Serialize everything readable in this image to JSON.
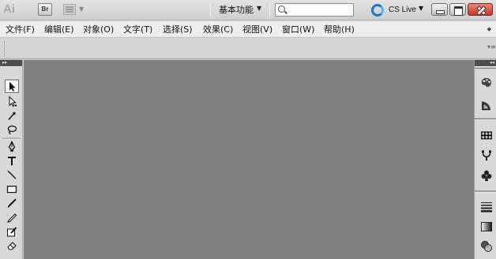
{
  "titlebar": {
    "app_logo": "Ai",
    "bridge_button": "Br",
    "workspace": "基本功能",
    "search_placeholder": "",
    "cslive": "CS Live",
    "icons": [
      "arrange-documents-icon",
      "caret-down-icon",
      "search-icon",
      "cslive-icon",
      "minimize-icon",
      "restore-icon",
      "close-icon"
    ]
  },
  "menu": {
    "items": [
      "文件(F)",
      "编辑(E)",
      "对象(O)",
      "文字(T)",
      "选择(S)",
      "效果(C)",
      "视图(V)",
      "窗口(W)",
      "帮助(H)"
    ]
  },
  "toolbox": {
    "collapse_glyph": "▸▸",
    "tools": [
      "selection-tool-icon",
      "direct-selection-tool-icon",
      "magic-wand-tool-icon",
      "lasso-tool-icon",
      "pen-tool-icon",
      "type-tool-icon",
      "line-segment-tool-icon",
      "rectangle-tool-icon",
      "paintbrush-tool-icon",
      "pencil-tool-icon",
      "blob-brush-tool-icon",
      "eraser-tool-icon"
    ],
    "active_tool": "selection-tool-icon"
  },
  "dock": {
    "collapse_glyph": "◂◂",
    "panels": [
      "color-panel-icon",
      "color-guide-panel-icon",
      "swatches-panel-icon",
      "brushes-panel-icon",
      "symbols-panel-icon",
      "stroke-panel-icon",
      "gradient-panel-icon",
      "transparency-panel-icon"
    ]
  },
  "colors": {
    "canvas": "#808080",
    "chrome": "#d8d8d8",
    "close_button": "#c2372a",
    "cslive_accent": "#1c77c9"
  }
}
